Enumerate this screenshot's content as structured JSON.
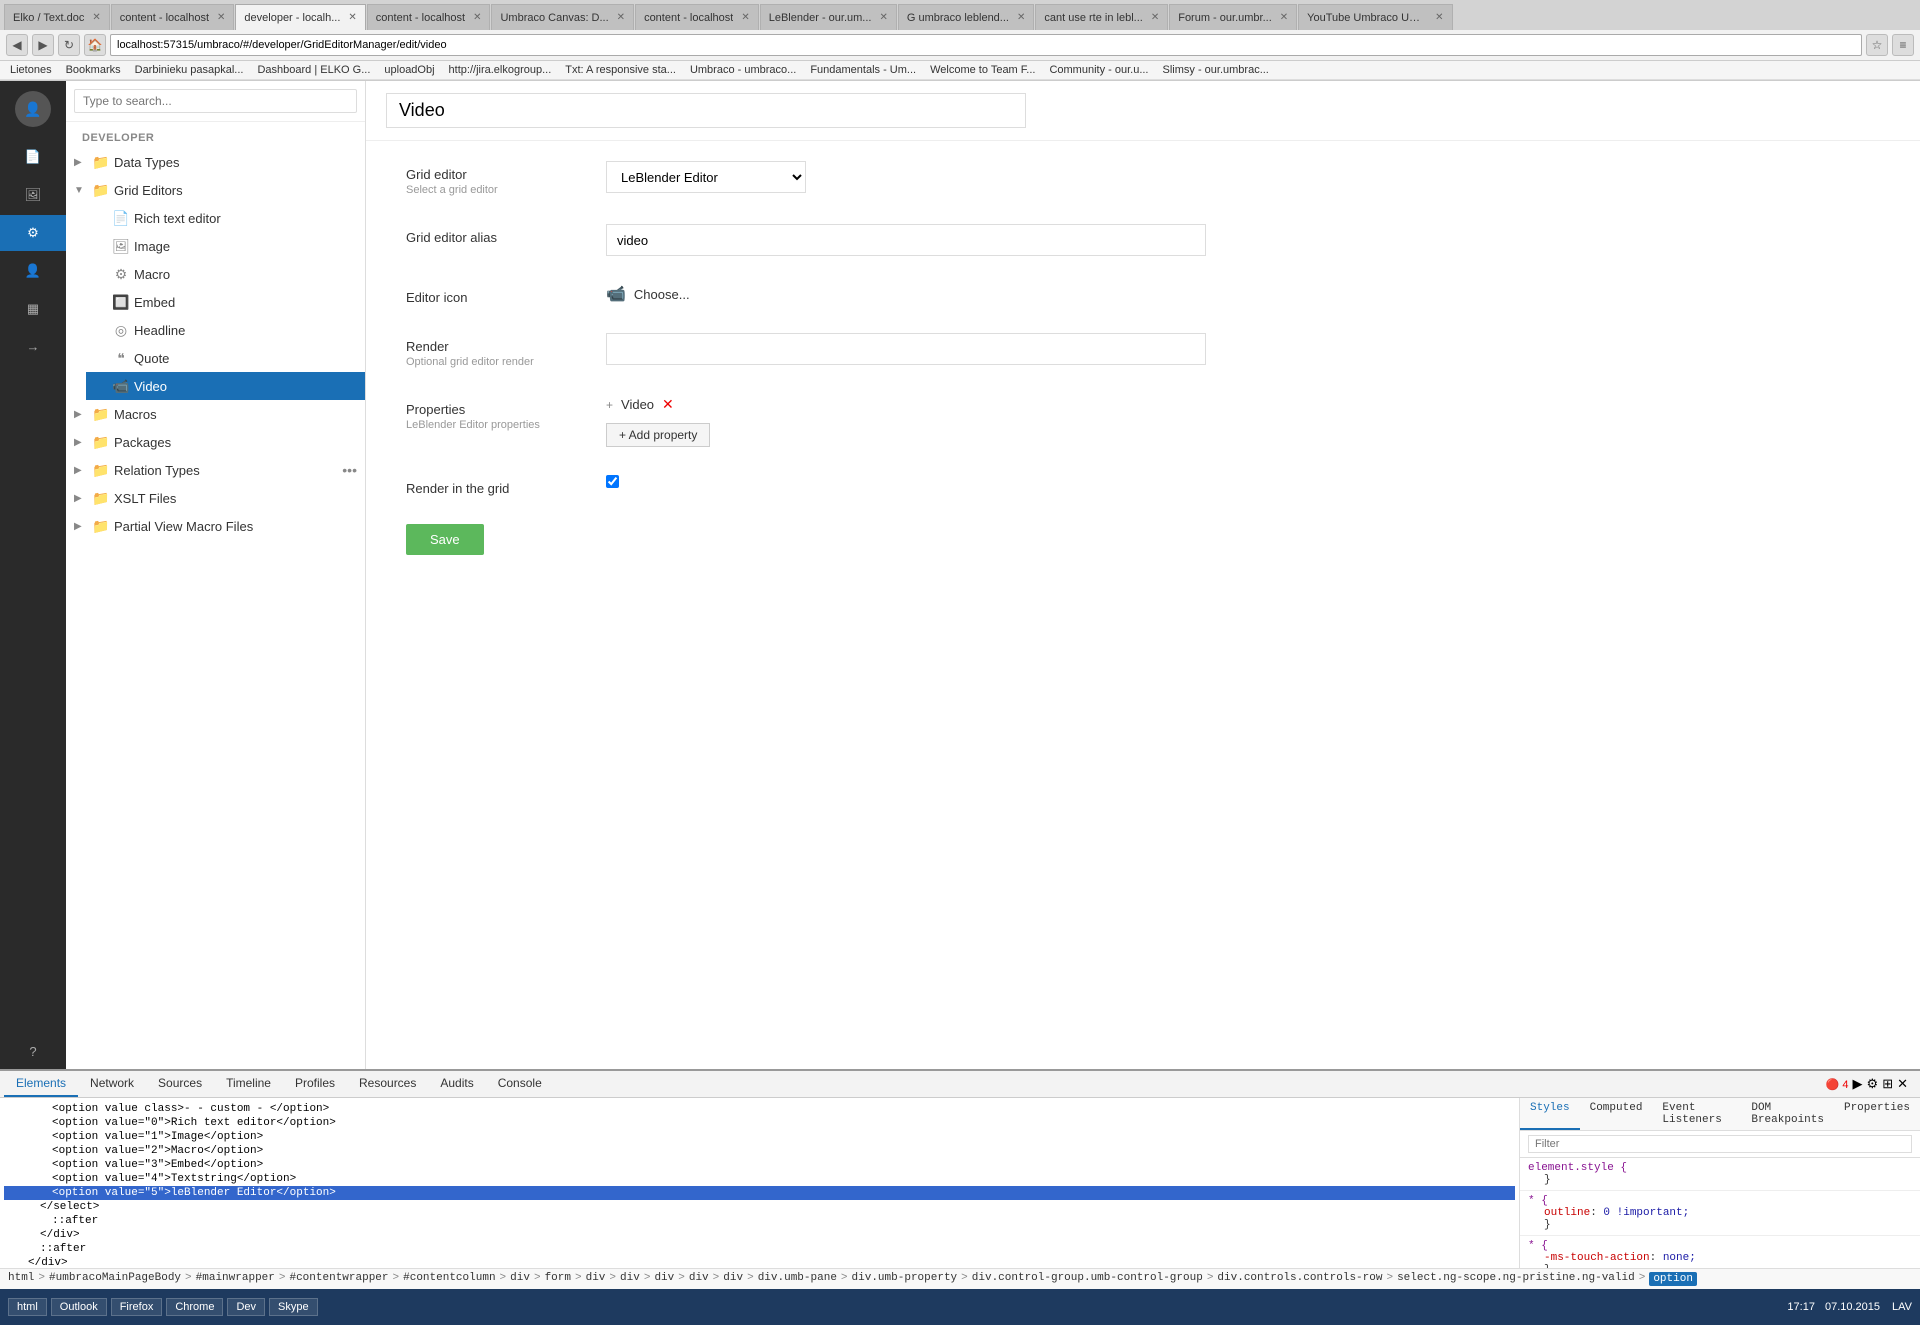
{
  "browser": {
    "tabs": [
      {
        "label": "Elko / Text.doc",
        "active": false
      },
      {
        "label": "content - localhost",
        "active": false
      },
      {
        "label": "developer - localh...",
        "active": true
      },
      {
        "label": "content - localhost",
        "active": false
      },
      {
        "label": "Umbraco Canvas: D...",
        "active": false
      },
      {
        "label": "content - localhost",
        "active": false
      },
      {
        "label": "LeBlender - our.um...",
        "active": false
      },
      {
        "label": "G umbraco leblend...",
        "active": false
      },
      {
        "label": "cant use rte in lebl...",
        "active": false
      },
      {
        "label": "Forum - our.umbr...",
        "active": false
      },
      {
        "label": "YouTube Umbraco UK Fe...",
        "active": false
      }
    ],
    "address": "localhost:57315/umbraco/#/developer/GridEditorManager/edit/video",
    "bookmarks": [
      "Lietones",
      "Bookmarks",
      "Darbinieku pasapkal...",
      "Dashboard | ELKO G...",
      "uploadObj",
      "http://jira.elkogroup...",
      "Txt: A responsive sta...",
      "Umbraco - umbraco...",
      "Fundamentals - Um...",
      "Welcome to Team F...",
      "Community - our.u...",
      "Slimsy - our.umbrac..."
    ]
  },
  "sidebar_icons": [
    {
      "name": "document-icon",
      "symbol": "📄"
    },
    {
      "name": "image-icon",
      "symbol": "🖼"
    },
    {
      "name": "gear-icon",
      "symbol": "⚙",
      "active": true
    },
    {
      "name": "user-icon",
      "symbol": "👤"
    },
    {
      "name": "grid-icon",
      "symbol": "▦"
    },
    {
      "name": "arrow-icon",
      "symbol": "→"
    },
    {
      "name": "help-icon",
      "symbol": "?"
    }
  ],
  "search": {
    "placeholder": "Type to search..."
  },
  "tree": {
    "section_label": "DEVELOPER",
    "items": [
      {
        "label": "Data Types",
        "expanded": false,
        "level": 0
      },
      {
        "label": "Grid Editors",
        "expanded": true,
        "level": 0,
        "children": [
          {
            "label": "Rich text editor"
          },
          {
            "label": "Image"
          },
          {
            "label": "Macro"
          },
          {
            "label": "Embed"
          },
          {
            "label": "Headline"
          },
          {
            "label": "Quote"
          },
          {
            "label": "Video",
            "active": true
          }
        ]
      },
      {
        "label": "Macros",
        "expanded": false,
        "level": 0
      },
      {
        "label": "Packages",
        "expanded": false,
        "level": 0
      },
      {
        "label": "Relation Types",
        "expanded": false,
        "level": 0,
        "has_dots": true
      },
      {
        "label": "XSLT Files",
        "expanded": false,
        "level": 0
      },
      {
        "label": "Partial View Macro Files",
        "expanded": false,
        "level": 0
      }
    ]
  },
  "form": {
    "title": "Video",
    "fields": {
      "grid_editor_label": "Grid editor",
      "grid_editor_sublabel": "Select a grid editor",
      "grid_editor_value": "LeBlender Editor",
      "grid_editor_options": [
        "- custom -",
        "Rich text editor",
        "Image",
        "Macro",
        "Embed",
        "Textstring",
        "LeBlender Editor"
      ],
      "alias_label": "Grid editor alias",
      "alias_value": "video",
      "icon_label": "Editor icon",
      "icon_preview": "📹",
      "icon_choose": "Choose...",
      "render_label": "Render",
      "render_sublabel": "Optional grid editor render",
      "render_value": "",
      "properties_label": "Properties",
      "properties_sublabel": "LeBlender Editor properties",
      "property_name": "Video",
      "add_property_label": "+ Add property",
      "render_in_grid_label": "Render in the grid",
      "save_label": "Save"
    }
  },
  "devtools": {
    "tabs": [
      "Elements",
      "Network",
      "Sources",
      "Timeline",
      "Profiles",
      "Resources",
      "Audits",
      "Console"
    ],
    "active_tab": "Elements",
    "right_tabs": [
      "Styles",
      "Computed",
      "Event Listeners",
      "DOM Breakpoints",
      "Properties"
    ],
    "active_right_tab": "Styles",
    "code_lines": [
      {
        "text": "<option value class>- - custom - </option>",
        "indent": 4
      },
      {
        "text": "<option value=\"0\">Rich text editor</option>",
        "indent": 4
      },
      {
        "text": "<option value=\"1\">Image</option>",
        "indent": 4
      },
      {
        "text": "<option value=\"2\">Macro</option>",
        "indent": 4
      },
      {
        "text": "<option value=\"3\">Embed</option>",
        "indent": 4
      },
      {
        "text": "<option value=\"4\">Textstring</option>",
        "indent": 4
      },
      {
        "text": "<option value=\"5\">leBlender Editor</option>",
        "indent": 4,
        "highlighted": true
      },
      {
        "text": "</select>",
        "indent": 3
      },
      {
        "text": "::after",
        "indent": 4
      },
      {
        "text": "</div>",
        "indent": 3
      },
      {
        "text": "::after",
        "indent": 3
      },
      {
        "text": "</div>",
        "indent": 2
      }
    ],
    "styles": [
      {
        "selector": "element.style {",
        "rules": []
      },
      {
        "selector": "* {",
        "rules": [
          {
            "prop": "outline",
            "val": "0 !important;",
            "link": "styles.min.css?..97664..."
          }
        ]
      },
      {
        "selector": "* {",
        "rules": [
          {
            "prop": "-ms-touch-action",
            "val": "none;",
            "link": "umbraco.css?cdv=197664..."
          }
        ]
      }
    ],
    "filter_placeholder": "Filter",
    "breadcrumb": [
      "html",
      "#umbracoMainPageBody",
      "#mainwrapper",
      "#contentwrapper",
      "#contentcolumn",
      "div",
      "form",
      "div",
      "div",
      "div",
      "div",
      "div",
      "div.umb-pane",
      "div.umb-property",
      "div.control-group.umb-control-group",
      "div.controls.controls-row",
      "select.ng-scope.ng-pristine.ng-valid",
      "option"
    ],
    "breadcrumb_active": "option",
    "toolbar_right": [
      "⚙",
      "☰",
      "✕"
    ],
    "error_count": "4"
  },
  "taskbar": {
    "apps": [
      {
        "label": "html"
      },
      {
        "label": "Outlook"
      },
      {
        "label": "Firefox"
      },
      {
        "label": "Chrome"
      },
      {
        "label": "Dev"
      },
      {
        "label": "Skype"
      }
    ],
    "time": "17:17",
    "date": "07.10.2015"
  }
}
